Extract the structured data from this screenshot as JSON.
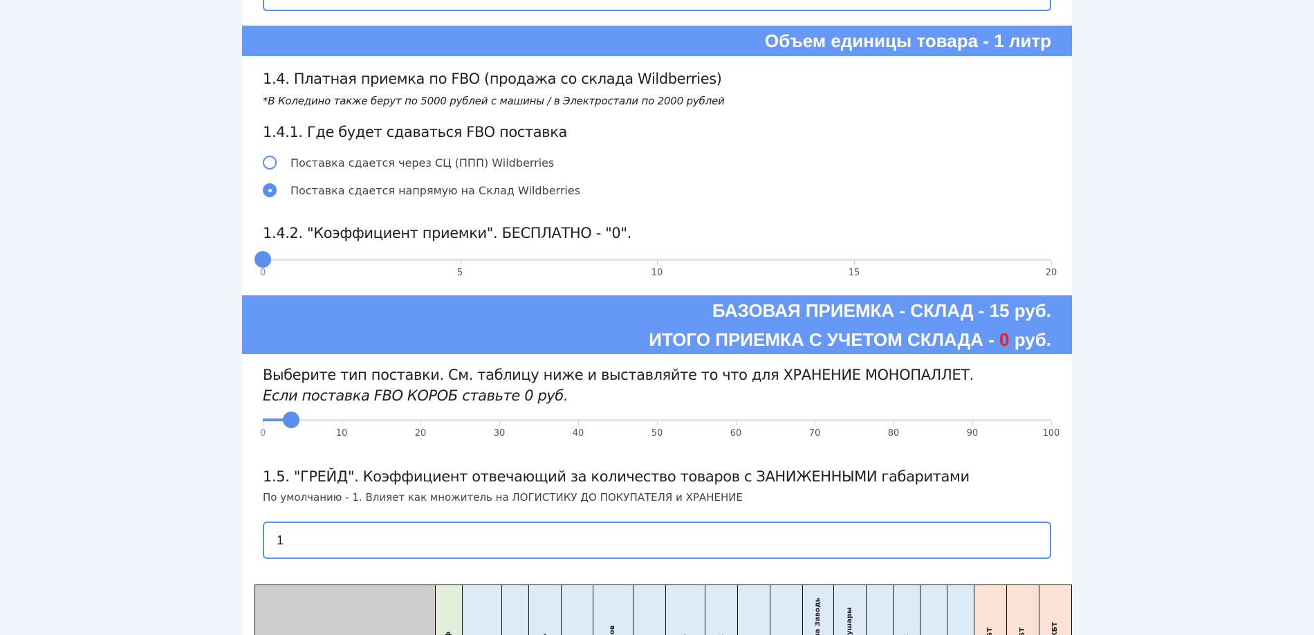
{
  "banner_volume": "Объем единицы товара - 1 литр",
  "section_1_4": {
    "title": "1.4. Платная приемка по FBO (продажа со склада Wildberries)",
    "note": "*В Коледино также берут по 5000 рублей с машины / в Электростали по 2000 рублей"
  },
  "section_1_4_1": {
    "title": "1.4.1. Где будет сдаваться FBO поставка",
    "options": [
      {
        "label": "Поставка сдается через СЦ (ППП) Wildberries",
        "selected": false
      },
      {
        "label": "Поставка сдается напрямую на Склад Wildberries",
        "selected": true
      }
    ]
  },
  "section_1_4_2": {
    "title": "1.4.2. \"Коэффициент приемки\". БЕСПЛАТНО - \"0\".",
    "slider": {
      "min": 0,
      "max": 20,
      "value": 0,
      "ticks": [
        "0",
        "5",
        "10",
        "15",
        "20"
      ]
    }
  },
  "banner_reception": {
    "line1": "БАЗОВАЯ ПРИЕМКА - СКЛАД - 15 руб.",
    "line2_prefix": "ИТОГО ПРИЕМКА С УЧЕТОМ СКЛАДА - ",
    "line2_value": "0",
    "line2_suffix": " руб."
  },
  "supply_type": {
    "title": "Выберите тип поставки. См. таблицу ниже и выставляйте то что для ХРАНЕНИЕ МОНОПАЛЛЕТ.",
    "subtitle": "Если поставка FBO КОРОБ ставьте 0 руб.",
    "slider": {
      "min": 0,
      "max": 100,
      "value": 3.6,
      "ticks": [
        "0",
        "10",
        "20",
        "30",
        "40",
        "50",
        "60",
        "70",
        "80",
        "90",
        "100"
      ]
    }
  },
  "section_1_5": {
    "title": "1.5. \"ГРЕЙД\". Коэффициент отвечающий за количество товаров с ЗАНИЖЕННЫМИ габаритами",
    "subtitle": "По умолчанию - 1. Влияет как множитель на ЛОГИСТИКУ ДО ПОКУПАТЕЛЯ и ХРАНЕНИЕ",
    "input_value": "1"
  },
  "table": {
    "columns": [
      {
        "label": "",
        "bg": "#cfcdcd"
      },
      {
        "label": "иф",
        "bg": "#e2efda"
      },
      {
        "label": "о",
        "bg": "#ddebf7"
      },
      {
        "label": "",
        "bg": "#ddebf7"
      },
      {
        "label": "ль",
        "bg": "#ddebf7"
      },
      {
        "label": "",
        "bg": "#ddebf7"
      },
      {
        "label": "ехов",
        "bg": "#ddebf7"
      },
      {
        "label": "а",
        "bg": "#ddebf7"
      },
      {
        "label": "во",
        "bg": "#ddebf7"
      },
      {
        "label": "ск",
        "bg": "#ddebf7"
      },
      {
        "label": "",
        "bg": "#ddebf7"
      },
      {
        "label": "о",
        "bg": "#ddebf7"
      },
      {
        "label": "ина Заводь",
        "bg": "#ddebf7"
      },
      {
        "label": "Шушары",
        "bg": "#ddebf7"
      },
      {
        "label": "рг",
        "bg": "#ddebf7"
      },
      {
        "label": "ск",
        "bg": "#ddebf7"
      },
      {
        "label": "",
        "bg": "#ddebf7"
      },
      {
        "label": "н",
        "bg": "#ddebf7"
      },
      {
        "label": "КБТ",
        "bg": "#fbe2d5"
      },
      {
        "label": "КБТ",
        "bg": "#fbe2d5"
      },
      {
        "label": "г КБТ",
        "bg": "#fbe2d5"
      }
    ]
  }
}
